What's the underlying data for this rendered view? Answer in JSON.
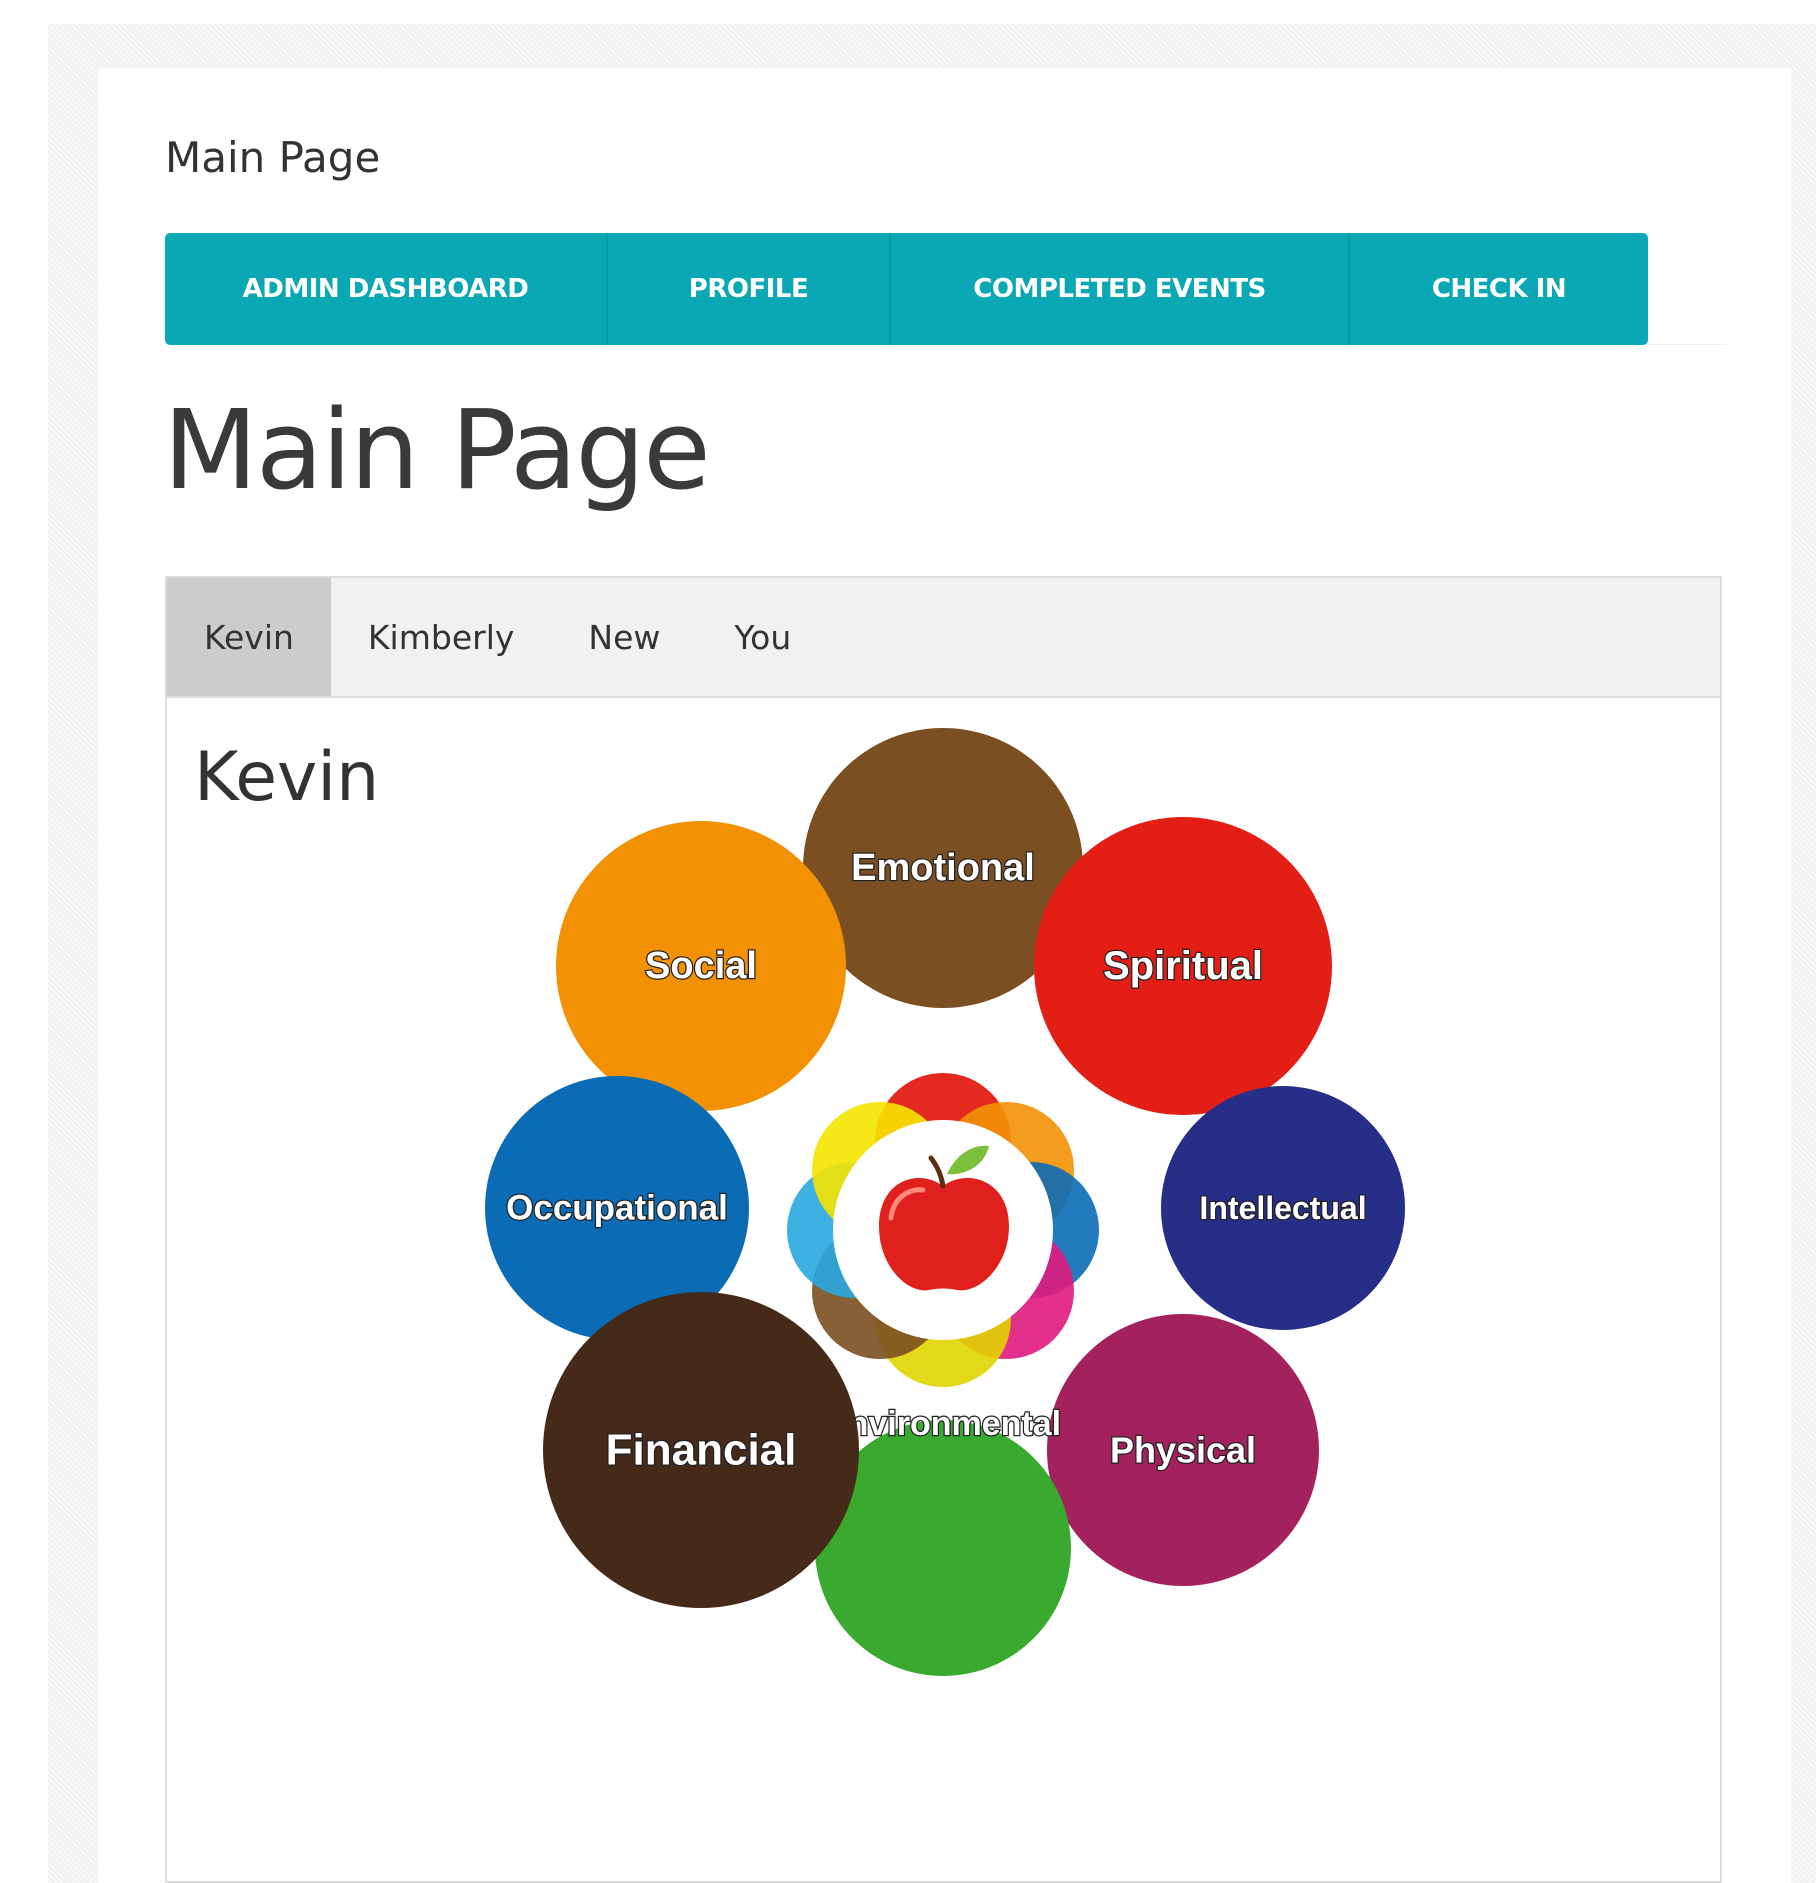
{
  "site": {
    "title": "Main Page"
  },
  "nav": {
    "items": [
      {
        "label": "ADMIN DASHBOARD"
      },
      {
        "label": "PROFILE"
      },
      {
        "label": "COMPLETED EVENTS"
      },
      {
        "label": "CHECK IN"
      }
    ],
    "color": "#0aa8b5"
  },
  "page": {
    "heading": "Main Page"
  },
  "tabs": {
    "items": [
      {
        "label": "Kevin",
        "active": true
      },
      {
        "label": "Kimberly",
        "active": false
      },
      {
        "label": "New",
        "active": false
      },
      {
        "label": "You",
        "active": false
      }
    ],
    "content_heading": "Kevin"
  },
  "wellness_wheel": {
    "center_icon": "apple-icon",
    "dimensions": [
      {
        "label": "Emotional",
        "color": "#7b4f22"
      },
      {
        "label": "Social",
        "color": "#f29104"
      },
      {
        "label": "Spiritual",
        "color": "#e31e14"
      },
      {
        "label": "Occupational",
        "color": "#0b6bb5"
      },
      {
        "label": "Intellectual",
        "color": "#272e87"
      },
      {
        "label": "Financial",
        "color": "#452a19"
      },
      {
        "label": "Physical",
        "color": "#a3215d"
      },
      {
        "label": "Environmental",
        "color": "#3aa92f"
      }
    ]
  }
}
